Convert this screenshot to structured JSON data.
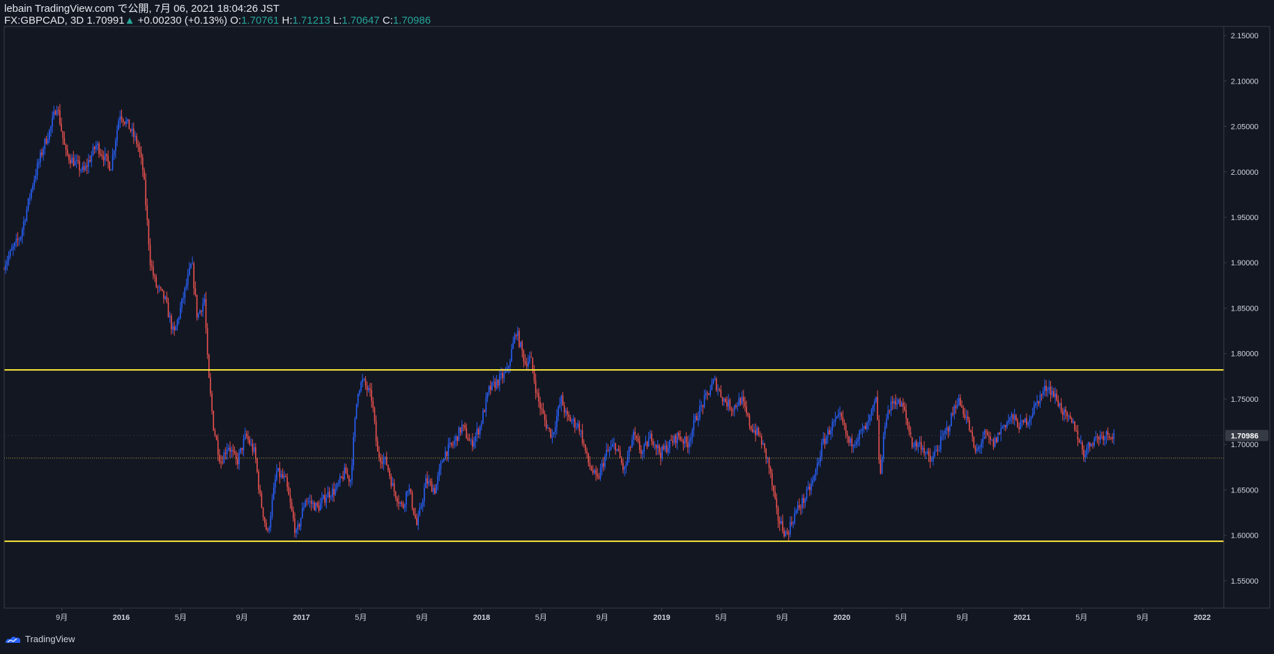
{
  "header": {
    "line1": "lebain TradingView.com で公開, 7月 06, 2021 18:04:26 JST",
    "symbol": "FX:GBPCAD, 3D",
    "last": "1.70991",
    "arrow": "▲",
    "change": "+0.00230 (+0.13%)",
    "o_label": "O:",
    "o": "1.70761",
    "h_label": "H:",
    "h": "1.71213",
    "l_label": "L:",
    "l": "1.70647",
    "c_label": "C:",
    "c": "1.70986"
  },
  "branding": {
    "label": "TradingView"
  },
  "colors": {
    "background": "#131722",
    "up": "#2962ff",
    "down": "#ef5350",
    "hline": "#ffeb3b",
    "axis_text": "#d1d4dc",
    "grid_border": "#3a3e4a",
    "price_label_bg": "#363a45"
  },
  "chart_data": {
    "type": "candlestick",
    "symbol": "FX:GBPCAD",
    "timeframe": "3D",
    "ylim": [
      1.52,
      2.16
    ],
    "yticks": [
      2.15,
      2.1,
      2.05,
      2.0,
      1.95,
      1.9,
      1.85,
      1.8,
      1.75,
      1.7,
      1.65,
      1.6,
      1.55
    ],
    "ytick_labels": [
      "2.15000",
      "2.10000",
      "2.05000",
      "2.00000",
      "1.95000",
      "1.90000",
      "1.85000",
      "1.80000",
      "1.75000",
      "1.70000",
      "1.65000",
      "1.60000",
      "1.55000"
    ],
    "xlim": [
      2015.35,
      2022.12
    ],
    "xticks": [
      {
        "t": 2015.67,
        "label": "9月"
      },
      {
        "t": 2016.0,
        "label": "2016"
      },
      {
        "t": 2016.33,
        "label": "5月"
      },
      {
        "t": 2016.67,
        "label": "9月"
      },
      {
        "t": 2017.0,
        "label": "2017"
      },
      {
        "t": 2017.33,
        "label": "5月"
      },
      {
        "t": 2017.67,
        "label": "9月"
      },
      {
        "t": 2018.0,
        "label": "2018"
      },
      {
        "t": 2018.33,
        "label": "5月"
      },
      {
        "t": 2018.67,
        "label": "9月"
      },
      {
        "t": 2019.0,
        "label": "2019"
      },
      {
        "t": 2019.33,
        "label": "5月"
      },
      {
        "t": 2019.67,
        "label": "9月"
      },
      {
        "t": 2020.0,
        "label": "2020"
      },
      {
        "t": 2020.33,
        "label": "5月"
      },
      {
        "t": 2020.67,
        "label": "9月"
      },
      {
        "t": 2021.0,
        "label": "2021"
      },
      {
        "t": 2021.33,
        "label": "5月"
      },
      {
        "t": 2021.67,
        "label": "9月"
      },
      {
        "t": 2022.0,
        "label": "2022"
      }
    ],
    "anchors": [
      [
        2015.35,
        1.895
      ],
      [
        2015.45,
        1.93
      ],
      [
        2015.52,
        1.99
      ],
      [
        2015.58,
        2.03
      ],
      [
        2015.62,
        2.05
      ],
      [
        2015.65,
        2.075
      ],
      [
        2015.7,
        2.02
      ],
      [
        2015.8,
        2.0
      ],
      [
        2015.87,
        2.03
      ],
      [
        2015.95,
        2.005
      ],
      [
        2016.0,
        2.065
      ],
      [
        2016.05,
        2.05
      ],
      [
        2016.1,
        2.03
      ],
      [
        2016.13,
        2.0
      ],
      [
        2016.17,
        1.9
      ],
      [
        2016.2,
        1.875
      ],
      [
        2016.25,
        1.86
      ],
      [
        2016.3,
        1.82
      ],
      [
        2016.35,
        1.86
      ],
      [
        2016.4,
        1.9
      ],
      [
        2016.43,
        1.84
      ],
      [
        2016.47,
        1.86
      ],
      [
        2016.49,
        1.78
      ],
      [
        2016.52,
        1.72
      ],
      [
        2016.56,
        1.68
      ],
      [
        2016.6,
        1.7
      ],
      [
        2016.65,
        1.68
      ],
      [
        2016.7,
        1.71
      ],
      [
        2016.75,
        1.69
      ],
      [
        2016.78,
        1.64
      ],
      [
        2016.82,
        1.6
      ],
      [
        2016.87,
        1.67
      ],
      [
        2016.92,
        1.66
      ],
      [
        2016.98,
        1.6
      ],
      [
        2017.03,
        1.64
      ],
      [
        2017.1,
        1.63
      ],
      [
        2017.15,
        1.645
      ],
      [
        2017.2,
        1.65
      ],
      [
        2017.25,
        1.67
      ],
      [
        2017.28,
        1.66
      ],
      [
        2017.32,
        1.76
      ],
      [
        2017.35,
        1.77
      ],
      [
        2017.4,
        1.75
      ],
      [
        2017.43,
        1.69
      ],
      [
        2017.48,
        1.68
      ],
      [
        2017.52,
        1.65
      ],
      [
        2017.57,
        1.63
      ],
      [
        2017.6,
        1.655
      ],
      [
        2017.65,
        1.61
      ],
      [
        2017.7,
        1.66
      ],
      [
        2017.75,
        1.65
      ],
      [
        2017.8,
        1.69
      ],
      [
        2017.85,
        1.7
      ],
      [
        2017.9,
        1.72
      ],
      [
        2017.95,
        1.7
      ],
      [
        2018.0,
        1.72
      ],
      [
        2018.05,
        1.76
      ],
      [
        2018.1,
        1.77
      ],
      [
        2018.15,
        1.78
      ],
      [
        2018.2,
        1.825
      ],
      [
        2018.25,
        1.79
      ],
      [
        2018.28,
        1.795
      ],
      [
        2018.32,
        1.75
      ],
      [
        2018.37,
        1.72
      ],
      [
        2018.4,
        1.71
      ],
      [
        2018.45,
        1.75
      ],
      [
        2018.48,
        1.73
      ],
      [
        2018.55,
        1.72
      ],
      [
        2018.6,
        1.68
      ],
      [
        2018.65,
        1.66
      ],
      [
        2018.7,
        1.69
      ],
      [
        2018.75,
        1.7
      ],
      [
        2018.8,
        1.67
      ],
      [
        2018.85,
        1.71
      ],
      [
        2018.9,
        1.69
      ],
      [
        2018.95,
        1.71
      ],
      [
        2019.0,
        1.69
      ],
      [
        2019.05,
        1.7
      ],
      [
        2019.1,
        1.71
      ],
      [
        2019.15,
        1.7
      ],
      [
        2019.2,
        1.73
      ],
      [
        2019.25,
        1.75
      ],
      [
        2019.3,
        1.77
      ],
      [
        2019.35,
        1.75
      ],
      [
        2019.4,
        1.74
      ],
      [
        2019.45,
        1.75
      ],
      [
        2019.5,
        1.72
      ],
      [
        2019.55,
        1.71
      ],
      [
        2019.6,
        1.68
      ],
      [
        2019.65,
        1.62
      ],
      [
        2019.7,
        1.6
      ],
      [
        2019.75,
        1.625
      ],
      [
        2019.8,
        1.64
      ],
      [
        2019.85,
        1.66
      ],
      [
        2019.9,
        1.7
      ],
      [
        2019.95,
        1.72
      ],
      [
        2020.0,
        1.73
      ],
      [
        2020.05,
        1.7
      ],
      [
        2020.1,
        1.71
      ],
      [
        2020.15,
        1.72
      ],
      [
        2020.2,
        1.75
      ],
      [
        2020.22,
        1.66
      ],
      [
        2020.25,
        1.73
      ],
      [
        2020.3,
        1.75
      ],
      [
        2020.35,
        1.74
      ],
      [
        2020.4,
        1.7
      ],
      [
        2020.45,
        1.7
      ],
      [
        2020.5,
        1.68
      ],
      [
        2020.55,
        1.7
      ],
      [
        2020.6,
        1.72
      ],
      [
        2020.65,
        1.75
      ],
      [
        2020.7,
        1.73
      ],
      [
        2020.75,
        1.69
      ],
      [
        2020.8,
        1.71
      ],
      [
        2020.85,
        1.7
      ],
      [
        2020.9,
        1.72
      ],
      [
        2020.95,
        1.73
      ],
      [
        2021.0,
        1.72
      ],
      [
        2021.05,
        1.73
      ],
      [
        2021.1,
        1.75
      ],
      [
        2021.15,
        1.765
      ],
      [
        2021.2,
        1.75
      ],
      [
        2021.25,
        1.73
      ],
      [
        2021.3,
        1.72
      ],
      [
        2021.35,
        1.69
      ],
      [
        2021.4,
        1.705
      ],
      [
        2021.45,
        1.71
      ],
      [
        2021.5,
        1.713
      ],
      [
        2021.51,
        1.7099
      ]
    ],
    "horizontal_lines": [
      {
        "price": 1.782,
        "style": "solid",
        "color": "#ffeb3b"
      },
      {
        "price": 1.5935,
        "style": "solid",
        "color": "#ffeb3b"
      },
      {
        "price": 1.685,
        "style": "dotted",
        "color": "#b6a93a"
      }
    ],
    "last_price_line": 1.70986,
    "last_price_label": "1.70986",
    "legend": "none",
    "grid": false
  }
}
